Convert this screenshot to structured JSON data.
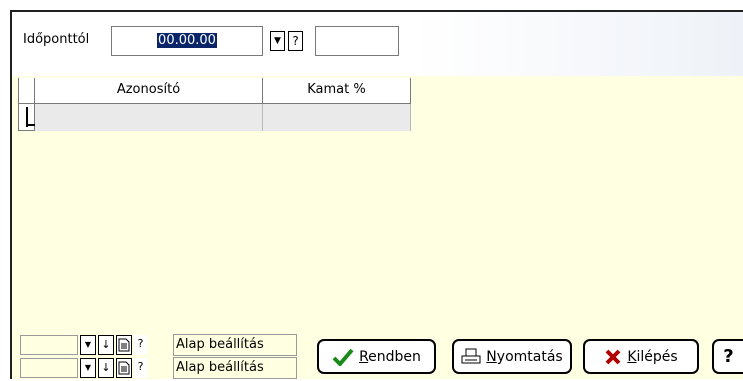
{
  "header": {
    "date_label": "Időponttól",
    "date_value": "00.00.00",
    "help_glyph": "?"
  },
  "table": {
    "columns": [
      "Azonosító",
      "Kamat %"
    ],
    "rows": [
      [
        "",
        ""
      ]
    ]
  },
  "filters": [
    {
      "value": "",
      "label": "Alap beállítás"
    },
    {
      "value": "",
      "label": "Alap beállítás"
    }
  ],
  "buttons": {
    "ok": {
      "mnemonic": "R",
      "rest": "endben"
    },
    "print": {
      "mnemonic": "N",
      "rest": "yomtatás"
    },
    "exit": {
      "mnemonic": "K",
      "rest": "ilépés"
    },
    "help": "?"
  },
  "icons": [
    "dropdown-arrow-icon",
    "down-arrow-icon",
    "document-icon",
    "help-icon",
    "check-icon",
    "printer-icon",
    "x-icon"
  ],
  "colors": {
    "panel": "#ffffe1",
    "selection": "#0a246a",
    "check": "#1a8a1a",
    "exit_x": "#b00000"
  }
}
